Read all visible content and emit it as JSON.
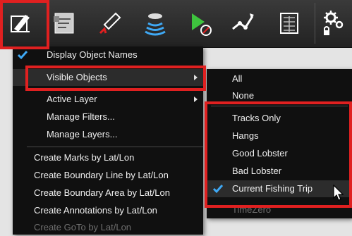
{
  "toolbar": {
    "buttons": [
      {
        "icon": "edit-chart-icon"
      },
      {
        "icon": "layers-icon"
      },
      {
        "icon": "route-icon"
      },
      {
        "icon": "sounder-icon"
      },
      {
        "icon": "navigate-to-icon"
      },
      {
        "icon": "structure-icon"
      },
      {
        "icon": "data-panel-icon"
      },
      {
        "icon": "settings-gear-icon"
      }
    ]
  },
  "main_menu": {
    "items": [
      {
        "label": "Display Object Names",
        "checked": true
      },
      {
        "label": "Visible Objects",
        "has_submenu": true,
        "highlighted": true
      },
      {
        "label": "Active Layer",
        "has_submenu": true
      },
      {
        "label": "Manage Filters..."
      },
      {
        "label": "Manage Layers..."
      },
      {
        "label": "Create Marks by Lat/Lon"
      },
      {
        "label": "Create Boundary Line by Lat/Lon"
      },
      {
        "label": "Create Boundary Area by Lat/Lon"
      },
      {
        "label": "Create Annotations by Lat/Lon"
      },
      {
        "label": "Create GoTo by Lat/Lon",
        "disabled": true
      }
    ]
  },
  "submenu": {
    "items": [
      {
        "label": "All"
      },
      {
        "label": "None"
      },
      {
        "label": "Tracks Only"
      },
      {
        "label": "Hangs"
      },
      {
        "label": "Good Lobster"
      },
      {
        "label": "Bad Lobster"
      },
      {
        "label": "Current Fishing Trip",
        "checked": true
      },
      {
        "label": "TimeZero",
        "disabled": true
      }
    ]
  },
  "colors": {
    "highlight_box": "#e02020",
    "check": "#3fa9f5",
    "menu_bg": "#101010",
    "menu_text": "#f0f0f0"
  }
}
